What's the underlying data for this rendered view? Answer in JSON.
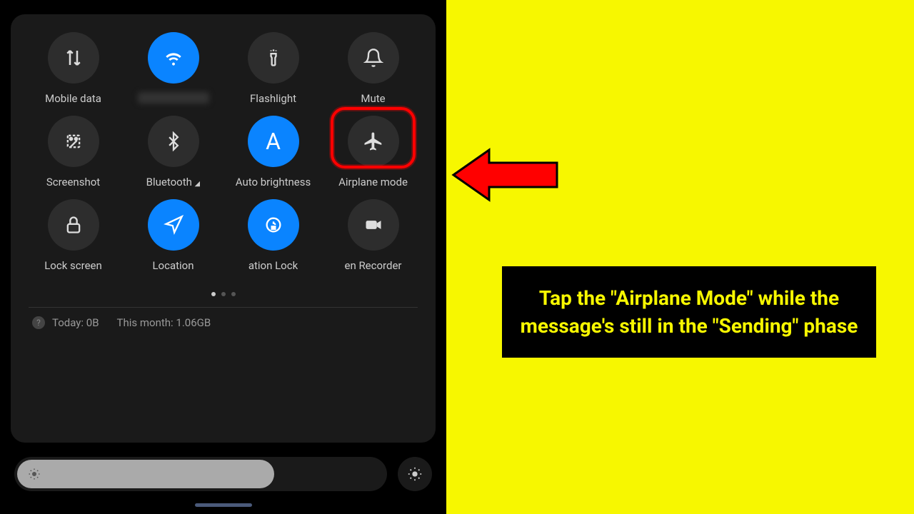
{
  "tiles": [
    {
      "label": "Mobile data",
      "icon": "mobile-data",
      "active": false
    },
    {
      "label": "(hidden)",
      "icon": "wifi",
      "active": true,
      "blurred": true
    },
    {
      "label": "Flashlight",
      "icon": "flashlight",
      "active": false
    },
    {
      "label": "Mute",
      "icon": "mute",
      "active": false
    },
    {
      "label": "Screenshot",
      "icon": "screenshot",
      "active": false
    },
    {
      "label": "Bluetooth",
      "icon": "bluetooth",
      "active": false,
      "hasChevron": true
    },
    {
      "label": "Auto brightness",
      "icon": "auto-brightness",
      "active": true
    },
    {
      "label": "Airplane mode",
      "icon": "airplane",
      "active": false,
      "highlighted": true
    },
    {
      "label": "Lock screen",
      "icon": "lock",
      "active": false
    },
    {
      "label": "Location",
      "icon": "location",
      "active": true
    },
    {
      "label": "ation   Lock",
      "icon": "rotation-lock",
      "active": true
    },
    {
      "label": "en Recorder",
      "icon": "recorder",
      "active": false
    }
  ],
  "usage": {
    "today_label": "Today:",
    "today_value": "0B",
    "month_label": "This month:",
    "month_value": "1.06GB"
  },
  "instruction": {
    "text": "Tap the \"Airplane Mode\" while the message's still in the \"Sending\" phase"
  },
  "icons": {
    "mobile-data": "mobile-data-icon",
    "wifi": "wifi-icon",
    "flashlight": "flashlight-icon",
    "mute": "bell-icon",
    "screenshot": "screenshot-icon",
    "bluetooth": "bluetooth-icon",
    "auto-brightness": "letter-a-icon",
    "airplane": "airplane-icon",
    "lock": "lock-icon",
    "location": "navigation-icon",
    "rotation-lock": "rotation-lock-icon",
    "recorder": "camera-icon"
  }
}
